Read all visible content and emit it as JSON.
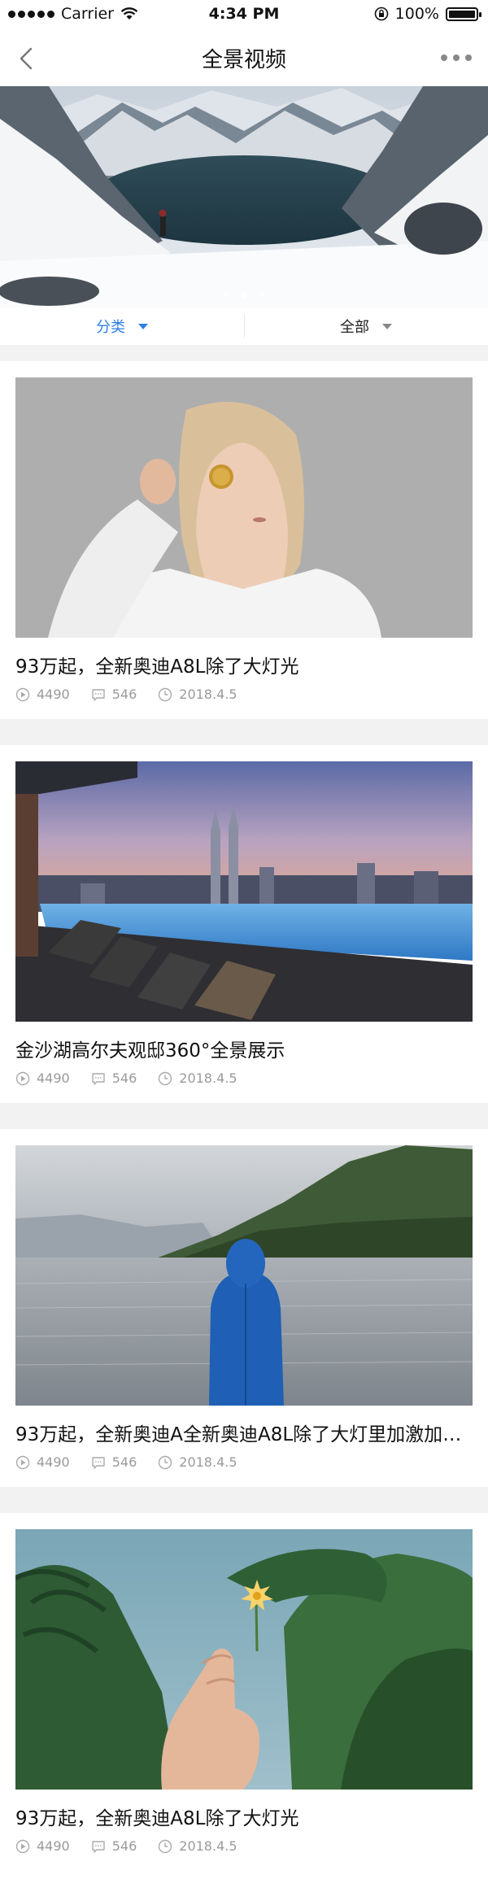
{
  "status_bar": {
    "carrier": "Carrier",
    "time": "4:34 PM",
    "battery": "100%"
  },
  "nav": {
    "title": "全景视频",
    "back_icon": "chevron-left-icon",
    "more_icon": "more-dots-icon"
  },
  "banner": {
    "slide_count": 3,
    "active_index": 1
  },
  "filters": {
    "category_label": "分类",
    "all_label": "全部",
    "accent_color": "#2f7ee6"
  },
  "cards": [
    {
      "title": "93万起，全新奥迪A8L除了大灯光",
      "views": "4490",
      "comments": "546",
      "date": "2018.4.5"
    },
    {
      "title": "金沙湖高尔夫观邸360°全景展示",
      "views": "4490",
      "comments": "546",
      "date": "2018.4.5"
    },
    {
      "title": "93万起，全新奥迪A全新奥迪A8L除了大灯里加激加光...",
      "views": "4490",
      "comments": "546",
      "date": "2018.4.5"
    },
    {
      "title": "93万起，全新奥迪A8L除了大灯光",
      "views": "4490",
      "comments": "546",
      "date": "2018.4.5"
    }
  ]
}
